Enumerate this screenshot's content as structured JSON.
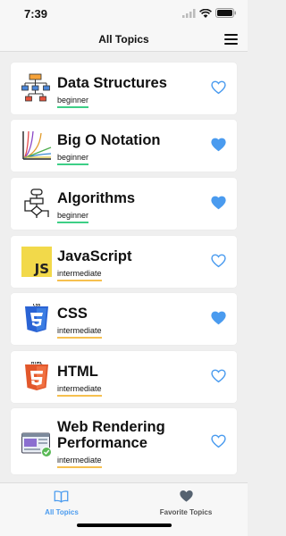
{
  "status_bar": {
    "time": "7:39"
  },
  "nav": {
    "title": "All Topics",
    "menu_icon": "hamburger-menu-icon"
  },
  "topics": [
    {
      "title_lines": [
        "Data Structures"
      ],
      "level": "beginner",
      "icon": "tree-diagram-icon",
      "favorite": false
    },
    {
      "title_lines": [
        "Big O Notation"
      ],
      "level": "beginner",
      "icon": "complexity-graph-icon",
      "favorite": true
    },
    {
      "title_lines": [
        "Algorithms"
      ],
      "level": "beginner",
      "icon": "flowchart-icon",
      "favorite": true
    },
    {
      "title_lines": [
        "JavaScript"
      ],
      "level": "intermediate",
      "icon": "javascript-logo-icon",
      "favorite": false
    },
    {
      "title_lines": [
        "CSS"
      ],
      "level": "intermediate",
      "icon": "css3-logo-icon",
      "favorite": true
    },
    {
      "title_lines": [
        "HTML"
      ],
      "level": "intermediate",
      "icon": "html5-logo-icon",
      "favorite": false
    },
    {
      "title_lines": [
        "Web Rendering",
        "Performance"
      ],
      "level": "intermediate",
      "icon": "web-performance-icon",
      "favorite": false
    }
  ],
  "tab_bar": {
    "tabs": [
      {
        "label": "All Topics",
        "icon": "book-icon",
        "active": true
      },
      {
        "label": "Favorite Topics",
        "icon": "heart-icon",
        "active": false
      }
    ]
  },
  "colors": {
    "accent": "#4a9bef",
    "beginner_underline": "#3dcf86",
    "intermediate_underline": "#f6c04f",
    "inactive_tab": "#555555"
  }
}
